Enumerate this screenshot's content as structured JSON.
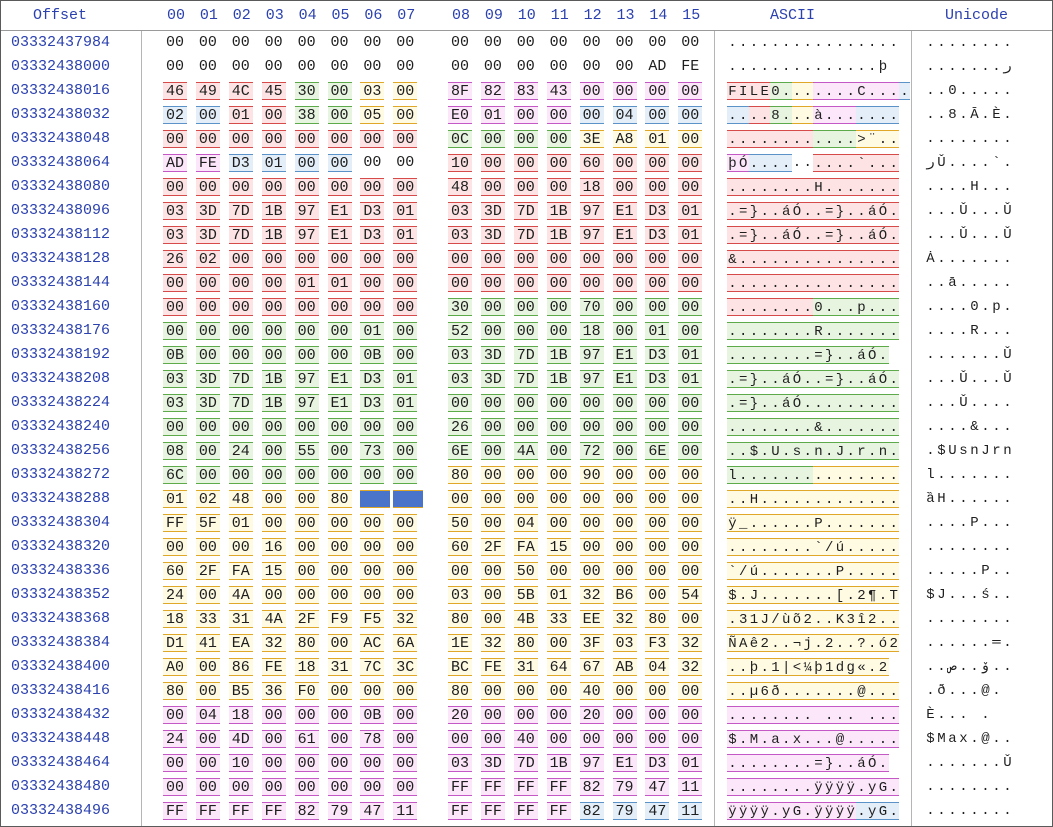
{
  "header": {
    "offset_label": "Offset",
    "columns": [
      "00",
      "01",
      "02",
      "03",
      "04",
      "05",
      "06",
      "07",
      "08",
      "09",
      "10",
      "11",
      "12",
      "13",
      "14",
      "15"
    ],
    "ascii_label": "ASCII",
    "unicode_label": "Unicode"
  },
  "colors": {
    "label_blue": "#2b41b0",
    "red_fill": "#fde3e3",
    "red_border": "#d64a4a",
    "green_fill": "#e7f5e0",
    "green_border": "#5daa4a",
    "yellow_fill": "#fffbe3",
    "yellow_border": "#e0a828",
    "pink_fill": "#fce6fa",
    "pink_border": "#c458c4",
    "blue_fill": "#e3eef9",
    "blue_border": "#5b93c9",
    "selection": "#4a74c9"
  },
  "selection": {
    "row": 12,
    "bytes": [
      6,
      7
    ]
  },
  "rows": [
    {
      "offset": "03332437984",
      "hex": "00 00 00 00 00 00 00 00 00 00 00 00 00 00 00 00",
      "ascii": "................",
      "unicode": "........"
    },
    {
      "offset": "03332438000",
      "hex": "00 00 00 00 00 00 00 00 00 00 00 00 00 00 AD FE",
      "ascii": "..............þ",
      "unicode": ".......ر"
    },
    {
      "offset": "03332438016",
      "hex": "46 49 4C 45 30 00 03 00 8F 82 83 43 00 00 00 00",
      "ascii": "FILE0.......C....",
      "unicode": "..0....."
    },
    {
      "offset": "03332438032",
      "hex": "02 00 01 00 38 00 05 00 E0 01 00 00 00 04 00 00",
      "ascii": "....8...à.......",
      "unicode": "..8.Ā.È."
    },
    {
      "offset": "03332438048",
      "hex": "00 00 00 00 00 00 00 00 0C 00 00 00 3E A8 01 00",
      "ascii": "............>¨..",
      "unicode": "........"
    },
    {
      "offset": "03332438064",
      "hex": "AD FE D3 01 00 00 00 00 10 00 00 00 60 00 00 00",
      "ascii": "þÓ..........`...",
      "unicode": "رǓ....`."
    },
    {
      "offset": "03332438080",
      "hex": "00 00 00 00 00 00 00 00 48 00 00 00 18 00 00 00",
      "ascii": "........H.......",
      "unicode": "....H..."
    },
    {
      "offset": "03332438096",
      "hex": "03 3D 7D 1B 97 E1 D3 01 03 3D 7D 1B 97 E1 D3 01",
      "ascii": ".=}..áÓ..=}..áÓ.",
      "unicode": "...Ǔ...Ǔ"
    },
    {
      "offset": "03332438112",
      "hex": "03 3D 7D 1B 97 E1 D3 01 03 3D 7D 1B 97 E1 D3 01",
      "ascii": ".=}..áÓ..=}..áÓ.",
      "unicode": "...Ǔ...Ǔ"
    },
    {
      "offset": "03332438128",
      "hex": "26 02 00 00 00 00 00 00 00 00 00 00 00 00 00 00",
      "ascii": "&...............",
      "unicode": "Ȧ......."
    },
    {
      "offset": "03332438144",
      "hex": "00 00 00 00 01 01 00 00 00 00 00 00 00 00 00 00",
      "ascii": "................",
      "unicode": "..ā....."
    },
    {
      "offset": "03332438160",
      "hex": "00 00 00 00 00 00 00 00 30 00 00 00 70 00 00 00",
      "ascii": "........0...p...",
      "unicode": "....0.p."
    },
    {
      "offset": "03332438176",
      "hex": "00 00 00 00 00 00 01 00 52 00 00 00 18 00 01 00",
      "ascii": "........R.......",
      "unicode": "....R..."
    },
    {
      "offset": "03332438192",
      "hex": "0B 00 00 00 00 00 0B 00 03 3D 7D 1B 97 E1 D3 01",
      "ascii": "........=}..áÓ.",
      "unicode": ".......Ǔ"
    },
    {
      "offset": "03332438208",
      "hex": "03 3D 7D 1B 97 E1 D3 01 03 3D 7D 1B 97 E1 D3 01",
      "ascii": ".=}..áÓ..=}..áÓ.",
      "unicode": "...Ǔ...Ǔ"
    },
    {
      "offset": "03332438224",
      "hex": "03 3D 7D 1B 97 E1 D3 01 00 00 00 00 00 00 00 00",
      "ascii": ".=}..áÓ.........",
      "unicode": "...Ǔ...."
    },
    {
      "offset": "03332438240",
      "hex": "00 00 00 00 00 00 00 00 26 00 00 00 00 00 00 00",
      "ascii": "........&.......",
      "unicode": "....&..."
    },
    {
      "offset": "03332438256",
      "hex": "08 00 24 00 55 00 73 00 6E 00 4A 00 72 00 6E 00",
      "ascii": "..$.U.s.n.J.r.n.",
      "unicode": ".$UsnJrn"
    },
    {
      "offset": "03332438272",
      "hex": "6C 00 00 00 00 00 00 00 80 00 00 00 90 00 00 00",
      "ascii": "l...............",
      "unicode": "l......."
    },
    {
      "offset": "03332438288",
      "hex": "01 02 48 00 00 80 __ __ 00 00 00 00 00 00 00 00",
      "ascii": "..H.............",
      "unicode": "ȁH......"
    },
    {
      "offset": "03332438304",
      "hex": "FF 5F 01 00 00 00 00 00 50 00 04 00 00 00 00 00",
      "ascii": "ÿ_......P.......",
      "unicode": "....P..."
    },
    {
      "offset": "03332438320",
      "hex": "00 00 00 16 00 00 00 00 60 2F FA 15 00 00 00 00",
      "ascii": "........`/ú.....",
      "unicode": "........"
    },
    {
      "offset": "03332438336",
      "hex": "60 2F FA 15 00 00 00 00 00 00 50 00 00 00 00 00",
      "ascii": "`/ú.......P.....",
      "unicode": ".....P.."
    },
    {
      "offset": "03332438352",
      "hex": "24 00 4A 00 00 00 00 00 03 00 5B 01 32 B6 00 54",
      "ascii": "$.J.......[.2¶.T",
      "unicode": "$J...ś.."
    },
    {
      "offset": "03332438368",
      "hex": "18 33 31 4A 2F F9 F5 32 80 00 4B 33 EE 32 80 00",
      "ascii": ".31J/ùõ2..K3î2..",
      "unicode": "........"
    },
    {
      "offset": "03332438384",
      "hex": "D1 41 EA 32 80 00 AC 6A 1E 32 80 00 3F 03 F3 32",
      "ascii": "ÑAê2..¬j.2..?.ó2",
      "unicode": "......═."
    },
    {
      "offset": "03332438400",
      "hex": "A0 00 86 FE 18 31 7C 3C BC FE 31 64 67 AB 04 32",
      "ascii": "..þ.1|<¼þ1dg«.2",
      "unicode": "..ص..ۆ.."
    },
    {
      "offset": "03332438416",
      "hex": "80 00 B5 36 F0 00 00 00 80 00 00 00 40 00 00 00",
      "ascii": "..µ6ð.......@...",
      "unicode": ".ð...@."
    },
    {
      "offset": "03332438432",
      "hex": "00 04 18 00 00 00 0B 00 20 00 00 00 20 00 00 00",
      "ascii": "........ ... ...",
      "unicode": "Ѐ... . "
    },
    {
      "offset": "03332438448",
      "hex": "24 00 4D 00 61 00 78 00 00 00 40 00 00 00 00 00",
      "ascii": "$.M.a.x...@.....",
      "unicode": "$Max.@.."
    },
    {
      "offset": "03332438464",
      "hex": "00 00 10 00 00 00 00 00 03 3D 7D 1B 97 E1 D3 01",
      "ascii": "........=}..áÓ.",
      "unicode": ".......Ǔ"
    },
    {
      "offset": "03332438480",
      "hex": "00 00 00 00 00 00 00 00 FF FF FF FF 82 79 47 11",
      "ascii": "........ÿÿÿÿ.yG.",
      "unicode": "........"
    },
    {
      "offset": "03332438496",
      "hex": "FF FF FF FF 82 79 47 11 FF FF FF FF 82 79 47 11",
      "ascii": "ÿÿÿÿ.yG.ÿÿÿÿ.yG.",
      "unicode": "........"
    }
  ]
}
